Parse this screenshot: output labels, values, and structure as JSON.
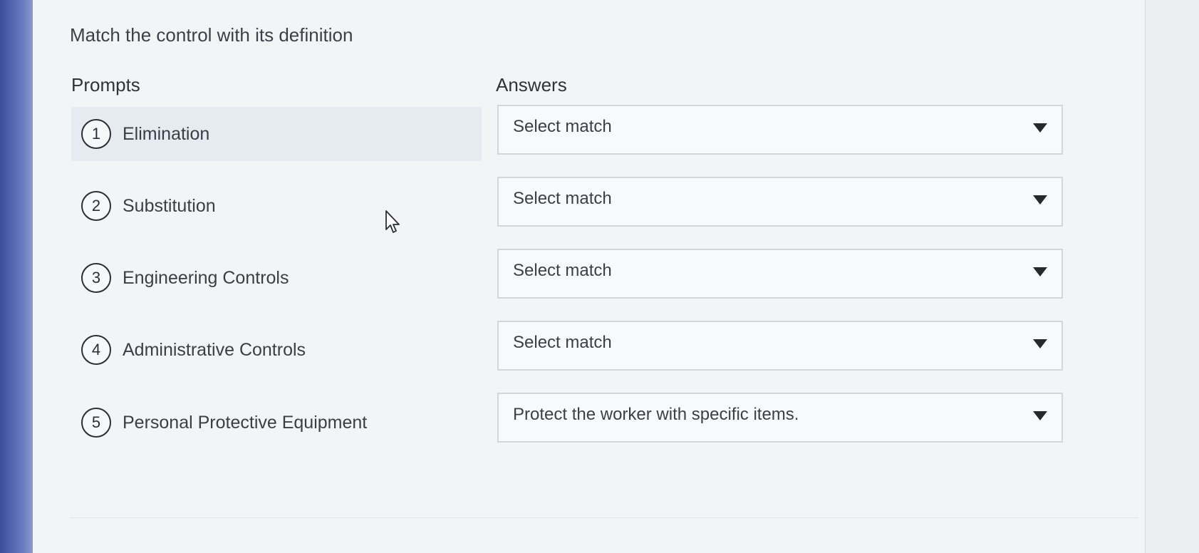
{
  "instruction": "Match the control with its definition",
  "columns": {
    "prompts": "Prompts",
    "answers": "Answers"
  },
  "rows": [
    {
      "number": "1",
      "prompt": "Elimination",
      "answer": "Select match"
    },
    {
      "number": "2",
      "prompt": "Substitution",
      "answer": "Select match"
    },
    {
      "number": "3",
      "prompt": "Engineering Controls",
      "answer": "Select match"
    },
    {
      "number": "4",
      "prompt": "Administrative Controls",
      "answer": "Select match"
    },
    {
      "number": "5",
      "prompt": "Personal Protective Equipment",
      "answer": "Protect the worker with specific items."
    }
  ],
  "icons": {
    "dropdown": "chevron-down-icon",
    "pointer": "mouse-pointer-icon"
  },
  "colors": {
    "sidebar_accent": "#5f6fb0",
    "panel_background": "#f3f4f6",
    "active_row_highlight": "#e6eaf1"
  }
}
